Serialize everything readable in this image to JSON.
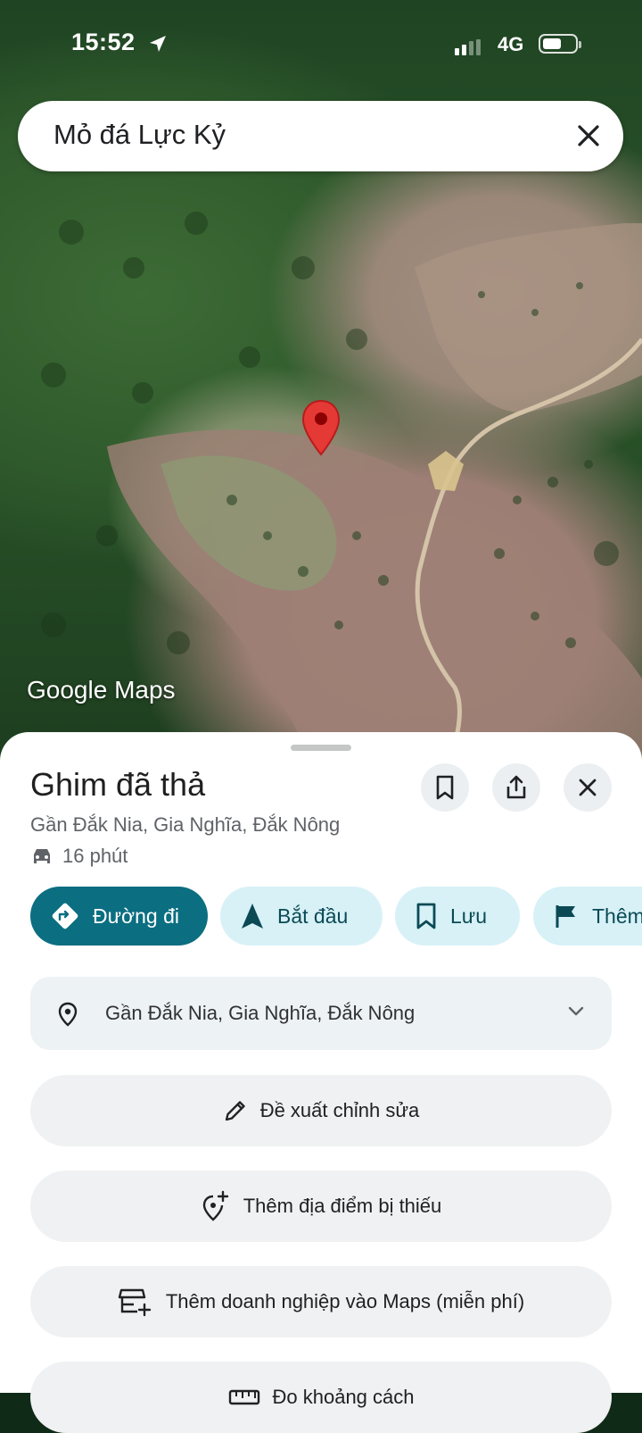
{
  "status_bar": {
    "time": "15:52",
    "network": "4G"
  },
  "search": {
    "query": "Mỏ đá Lực Kỷ"
  },
  "map": {
    "attribution": "Google Maps",
    "view": "satellite"
  },
  "place": {
    "title": "Ghim đã thả",
    "address": "Gần Đắk Nia, Gia Nghĩa, Đắk Nông",
    "drive_time": "16 phút"
  },
  "chips": [
    {
      "label": "Đường đi",
      "icon": "directions-icon"
    },
    {
      "label": "Bắt đầu",
      "icon": "navigation-arrow-icon"
    },
    {
      "label": "Lưu",
      "icon": "bookmark-icon"
    },
    {
      "label": "Thêm",
      "icon": "flag-icon"
    }
  ],
  "address_row": {
    "label": "Gần Đắk Nia, Gia Nghĩa, Đắk Nông"
  },
  "actions": [
    {
      "label": "Đề xuất chỉnh sửa",
      "icon": "pencil-icon"
    },
    {
      "label": "Thêm địa điểm bị thiếu",
      "icon": "add-place-icon"
    },
    {
      "label": "Thêm doanh nghiệp vào Maps (miễn phí)",
      "icon": "add-business-icon"
    },
    {
      "label": "Đo khoảng cách",
      "icon": "ruler-icon"
    }
  ],
  "colors": {
    "primary": "#0b6e81",
    "chip_secondary": "#d7f1f7",
    "pin": "#e53935"
  }
}
